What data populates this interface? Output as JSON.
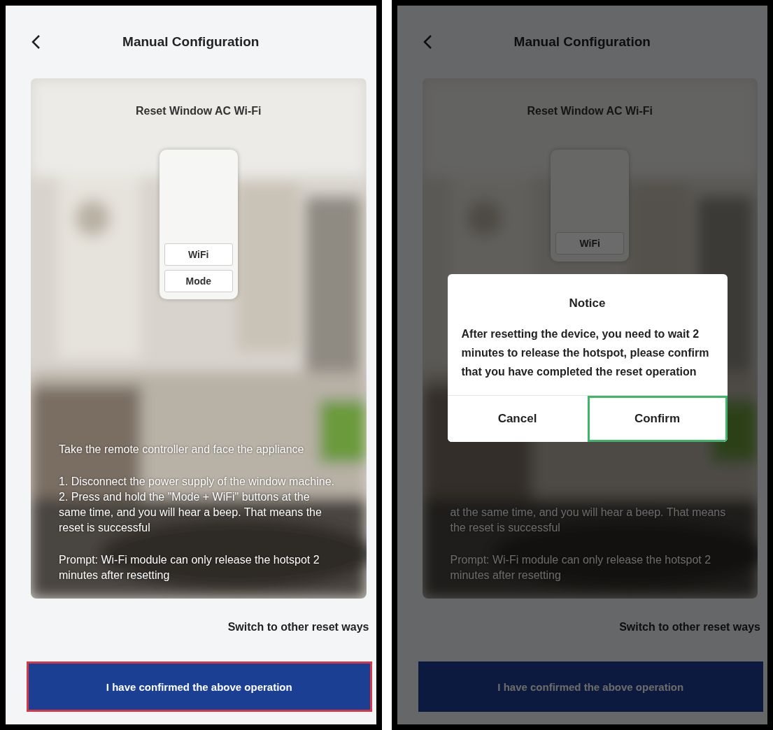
{
  "screens": [
    {
      "header": {
        "title": "Manual Configuration"
      },
      "card": {
        "title": "Reset Window AC Wi-Fi",
        "remote_keys": [
          "WiFi",
          "Mode"
        ],
        "instructions": [
          "Take the remote controller and face the appliance",
          "1. Disconnect the power supply of the window machine.\n2. Press and hold the \"Mode + WiFi\" buttons at the same time, and you will hear a beep. That means the reset is successful",
          "Prompt: Wi-Fi module can only release the hotspot 2 minutes after resetting"
        ]
      },
      "switch_link": "Switch to other reset ways",
      "confirm_button": {
        "label": "I have confirmed the above operation",
        "highlighted": true
      }
    },
    {
      "header": {
        "title": "Manual Configuration"
      },
      "card": {
        "title": "Reset Window AC Wi-Fi",
        "remote_keys": [
          "WiFi"
        ],
        "instructions": [
          "at the same time, and you will hear a beep. That means the reset is successful",
          "Prompt: Wi-Fi module can only release the hotspot 2 minutes after resetting"
        ]
      },
      "switch_link": "Switch to other reset ways",
      "confirm_button": {
        "label": "I have confirmed the above operation",
        "highlighted": false
      },
      "dialog": {
        "title": "Notice",
        "message": "After resetting the device, you need to wait 2 minutes to release the hotspot, please confirm that you have completed the reset operation",
        "buttons": [
          {
            "label": "Cancel",
            "highlighted": false
          },
          {
            "label": "Confirm",
            "highlighted": true
          }
        ]
      }
    }
  ]
}
